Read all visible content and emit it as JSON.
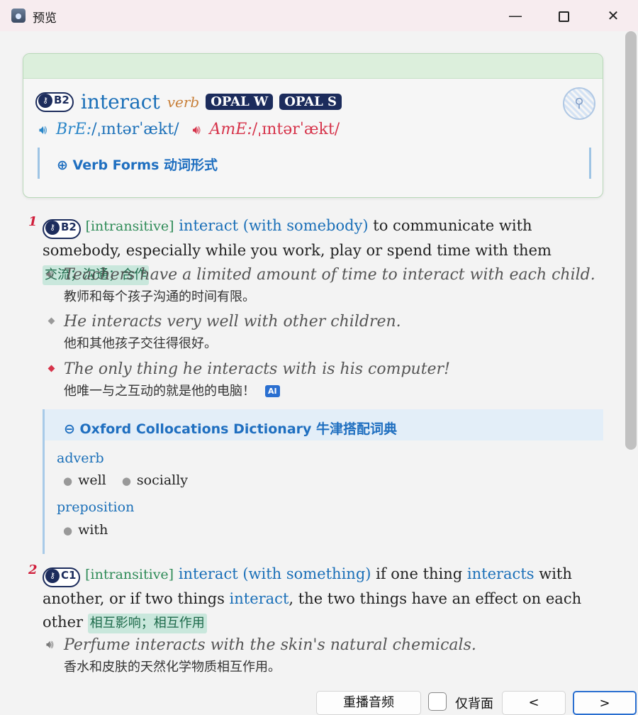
{
  "window": {
    "title": "预览",
    "minimize": "—",
    "close": "✕"
  },
  "entry": {
    "level": "B2",
    "headword": "interact",
    "pos": "verb",
    "badges": [
      "OPAL W",
      "OPAL S"
    ],
    "pron_br_label": "BrE",
    "pron_br": "/ˌɪntərˈækt/",
    "pron_am_label": "AmE",
    "pron_am": "/ˌɪntərˈækt/",
    "verb_forms": "⊕ Verb Forms 动词形式"
  },
  "senses": [
    {
      "num": "1",
      "level": "B2",
      "grammar": "[intransitive]",
      "cf": "interact (with somebody)",
      "def": " to communicate with somebody, especially while you work, play or spend time with them ",
      "cn": "交流；沟通；合作",
      "examples": [
        {
          "en": "Teachers have a limited amount of time to interact with each child.",
          "cn": "教师和每个孩子沟通的时间有限。"
        },
        {
          "en": "He interacts very well with other children.",
          "cn": "他和其他孩子交往得很好。"
        },
        {
          "en": "The only thing he interacts with is his computer!",
          "cn": "他唯一与之互动的就是他的电脑！",
          "ai": "AI"
        }
      ]
    },
    {
      "num": "2",
      "level": "C1",
      "grammar": "[intransitive]",
      "cf": "interact (with something)",
      "def_a": " if one thing ",
      "def_w1": "interacts",
      "def_b": " with another, or if two things ",
      "def_w2": "interact",
      "def_c": ", the two things have an effect on each other ",
      "cn": "相互影响；相互作用",
      "examples": [
        {
          "en": "Perfume interacts with the skin's natural chemicals.",
          "cn": "香水和皮肤的天然化学物质相互作用。"
        }
      ]
    }
  ],
  "collocations": {
    "title": "⊖ Oxford Collocations Dictionary 牛津搭配词典",
    "groups": [
      {
        "label": "adverb",
        "items": [
          "well",
          "socially"
        ]
      },
      {
        "label": "preposition",
        "items": [
          "with"
        ]
      }
    ]
  },
  "bottom": {
    "replay": "重播音频",
    "back_only": "仅背面",
    "prev": "<",
    "next": ">"
  },
  "colors": {
    "headword": "#1a6fb8",
    "sense_number": "#d01d3a",
    "grammar": "#2e8b57",
    "badge_navy": "#1c2c5c"
  }
}
